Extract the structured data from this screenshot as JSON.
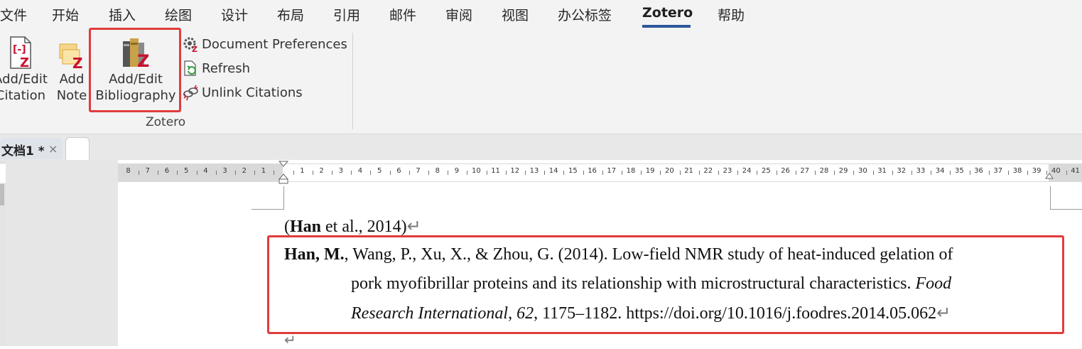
{
  "ribbon_tabs": [
    {
      "label": "文件"
    },
    {
      "label": "开始"
    },
    {
      "label": "插入"
    },
    {
      "label": "绘图"
    },
    {
      "label": "设计"
    },
    {
      "label": "布局"
    },
    {
      "label": "引用"
    },
    {
      "label": "邮件"
    },
    {
      "label": "审阅"
    },
    {
      "label": "视图"
    },
    {
      "label": "办公标签"
    },
    {
      "label": "Zotero"
    },
    {
      "label": "帮助"
    }
  ],
  "active_tab": "Zotero",
  "zotero_group": {
    "label": "Zotero",
    "add_edit_citation": {
      "line1": "Add/Edit",
      "line2": "Citation"
    },
    "add_note": {
      "line1": "Add",
      "line2": "Note"
    },
    "add_edit_bibliography": {
      "line1": "Add/Edit",
      "line2": "Bibliography"
    },
    "document_preferences": "Document Preferences",
    "refresh": "Refresh",
    "unlink_citations": "Unlink Citations"
  },
  "document_tab": {
    "title": "文档1 *",
    "close": "×"
  },
  "ruler": {
    "left_numbers": [
      "8",
      "7",
      "6",
      "5",
      "4",
      "3",
      "2",
      "1"
    ],
    "right_numbers": [
      "1",
      "2",
      "3",
      "4",
      "5",
      "6",
      "7",
      "8",
      "9",
      "10",
      "11",
      "12",
      "13",
      "14",
      "15",
      "16",
      "17",
      "18",
      "19",
      "20",
      "21",
      "22",
      "23",
      "24",
      "25",
      "26",
      "27",
      "28",
      "29",
      "30",
      "31",
      "32",
      "33",
      "34",
      "35",
      "36",
      "37",
      "38",
      "39",
      "40",
      "41"
    ]
  },
  "document": {
    "citation": {
      "author": "Han",
      "rest": " et al., 2014)",
      "open": "("
    },
    "bibliography": {
      "author_bold": "Han, M.",
      "line1_rest": ", Wang, P., Xu, X., & Zhou, G. (2014). Low-field NMR study of heat-induced gelation of",
      "line2": "pork myofibrillar proteins and its relationship with microstructural characteristics. ",
      "line2_italic": "Food",
      "line3_italic": "Research International",
      "line3_sep": ", ",
      "volume_italic": "62",
      "line3_rest": ", 1175–1182. https://doi.org/10.1016/j.foodres.2014.05.062"
    },
    "paragraph_mark": "↵"
  },
  "colors": {
    "highlight": "#e03c3c",
    "zotero_red": "#c8102e",
    "active_underline": "#2b579a"
  }
}
